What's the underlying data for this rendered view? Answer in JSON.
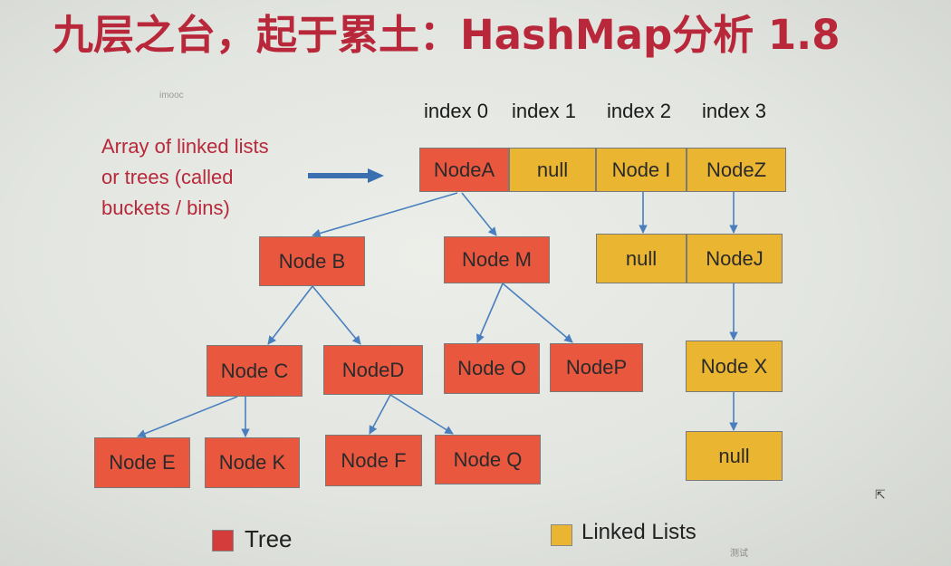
{
  "title": "九层之台，起于累土：HashMap分析 1.8",
  "watermark": "imooc",
  "index_labels": [
    "index 0",
    "index 1",
    "index 2",
    "index 3"
  ],
  "description": [
    "Array of linked lists",
    "or trees (called",
    "buckets / bins)"
  ],
  "array": [
    "NodeA",
    "null",
    "Node I",
    "NodeZ"
  ],
  "tree_nodes": {
    "b": "Node B",
    "m": "Node M",
    "c": "Node C",
    "d": "NodeD",
    "o": "Node O",
    "p": "NodeP",
    "e": "Node E",
    "k": "Node K",
    "f": "Node F",
    "q": "Node Q"
  },
  "list_nodes": {
    "null1": "null",
    "j": "NodeJ",
    "x": "Node X",
    "null2": "null"
  },
  "legend": {
    "tree": "Tree",
    "lists": "Linked Lists"
  },
  "colors": {
    "tree": "#e9573f",
    "list": "#eab531",
    "title": "#b8283a",
    "arrow": "#3a6fb0",
    "edge": "#4a7fbf"
  },
  "corner_text": "测试"
}
